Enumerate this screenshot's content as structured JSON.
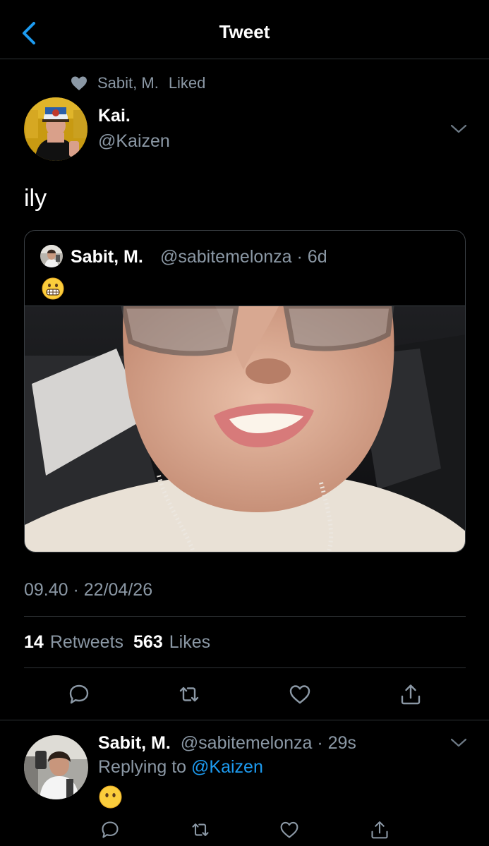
{
  "header": {
    "title": "Tweet"
  },
  "social_context": {
    "liker": "Sabit, M.",
    "action": "Liked"
  },
  "tweet": {
    "author_name": "Kai.",
    "author_handle": "@Kaizen",
    "text": "ily",
    "timestamp": "09.40 · 22/04/26",
    "retweets_count": "14",
    "retweets_label": "Retweets",
    "likes_count": "563",
    "likes_label": "Likes"
  },
  "quoted": {
    "name": "Sabit, M.",
    "meta": "@sabitemelonza · 6d"
  },
  "reply": {
    "name": "Sabit, M.",
    "meta": "@sabitemelonza · 29s",
    "replying_prefix": "Replying to ",
    "replying_mention": "@Kaizen"
  },
  "colors": {
    "accent": "#1d9bf0",
    "secondary_text": "#8b98a5",
    "border": "#2f3336",
    "background": "#000000"
  },
  "icons": {
    "back": "chevron-left-icon",
    "liked": "heart-icon",
    "caret": "chevron-down-icon",
    "reply": "reply-icon",
    "retweet": "retweet-icon",
    "like": "heart-icon",
    "share": "share-icon",
    "grimace_emoji": "grimacing-face-emoji",
    "no_mouth_emoji": "face-without-mouth-emoji"
  }
}
